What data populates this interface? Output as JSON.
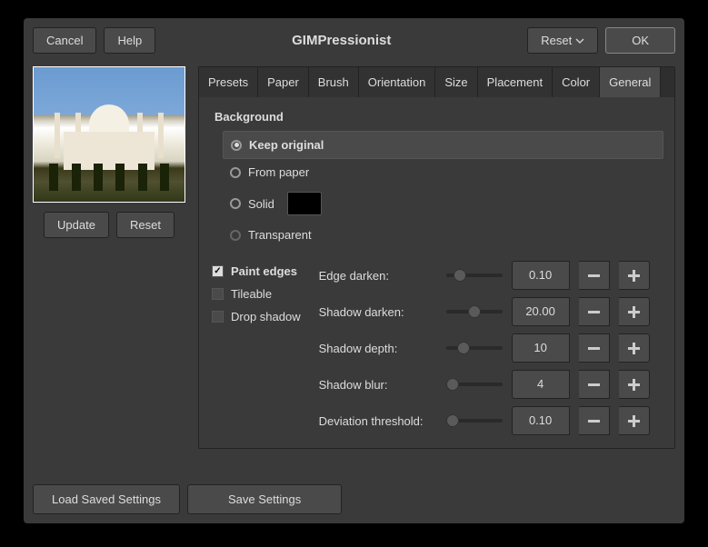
{
  "title": "GIMPressionist",
  "buttons": {
    "cancel": "Cancel",
    "help": "Help",
    "reset": "Reset",
    "ok": "OK",
    "update": "Update",
    "preview_reset": "Reset",
    "load": "Load Saved Settings",
    "save": "Save Settings"
  },
  "tabs": [
    "Presets",
    "Paper",
    "Brush",
    "Orientation",
    "Size",
    "Placement",
    "Color",
    "General"
  ],
  "active_tab": "General",
  "section": "Background",
  "bg_options": {
    "keep": "Keep original",
    "paper": "From paper",
    "solid": "Solid",
    "transparent": "Transparent"
  },
  "bg_selected": "keep",
  "solid_color": "#000000",
  "checks": {
    "paint_edges": {
      "label": "Paint edges",
      "checked": true
    },
    "tileable": {
      "label": "Tileable",
      "checked": false
    },
    "drop_shadow": {
      "label": "Drop shadow",
      "checked": false
    }
  },
  "sliders": {
    "edge_darken": {
      "label": "Edge darken:",
      "value": "0.10",
      "pos": 8
    },
    "shadow_darken": {
      "label": "Shadow darken:",
      "value": "20.00",
      "pos": 24
    },
    "shadow_depth": {
      "label": "Shadow depth:",
      "value": "10",
      "pos": 12
    },
    "shadow_blur": {
      "label": "Shadow blur:",
      "value": "4",
      "pos": 0
    },
    "deviation": {
      "label": "Deviation threshold:",
      "value": "0.10",
      "pos": 0
    }
  }
}
